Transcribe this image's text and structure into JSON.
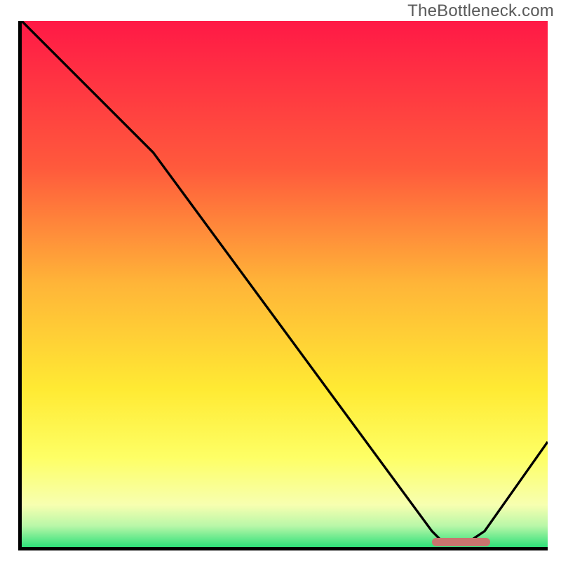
{
  "watermark": "TheBottleneck.com",
  "chart_data": {
    "type": "line",
    "title": "",
    "xlabel": "",
    "ylabel": "",
    "xlim": [
      0,
      100
    ],
    "ylim": [
      0,
      100
    ],
    "x": [
      0,
      25,
      78,
      80,
      85,
      88,
      100
    ],
    "values": [
      100,
      75,
      3,
      1,
      1,
      3,
      20
    ],
    "optimum_marker": {
      "x_start": 78,
      "x_end": 89,
      "y": 1
    },
    "background": {
      "stops": [
        {
          "pct": 0,
          "color": "#ff1946"
        },
        {
          "pct": 28,
          "color": "#ff5a3c"
        },
        {
          "pct": 50,
          "color": "#ffb538"
        },
        {
          "pct": 70,
          "color": "#ffea33"
        },
        {
          "pct": 83,
          "color": "#feff65"
        },
        {
          "pct": 92,
          "color": "#f7ffb0"
        },
        {
          "pct": 96,
          "color": "#b9f7a8"
        },
        {
          "pct": 100,
          "color": "#2fe07a"
        }
      ]
    }
  }
}
